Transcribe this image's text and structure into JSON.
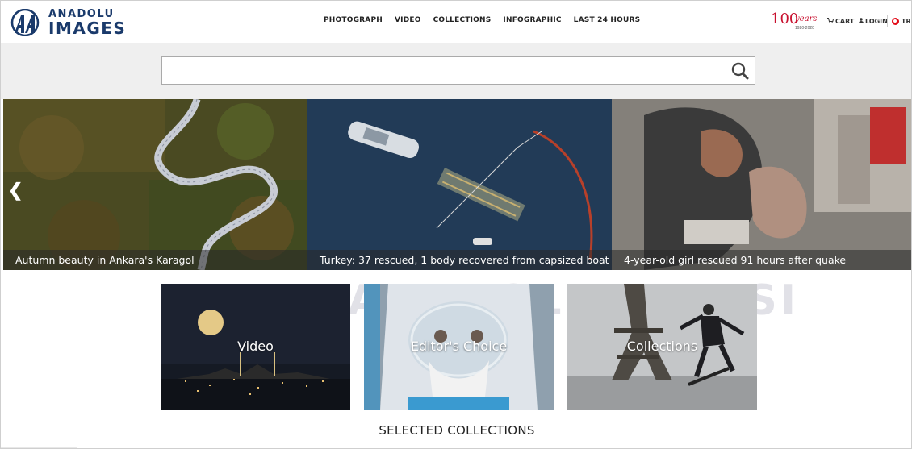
{
  "brand": {
    "line1": "ANADOLU",
    "line2": "IMAGES"
  },
  "nav": [
    "PHOTOGRAPH",
    "VIDEO",
    "COLLECTIONS",
    "INFOGRAPHIC",
    "LAST 24 HOURS"
  ],
  "centennial": {
    "number": "100",
    "word": "years",
    "range": "1920-2020"
  },
  "header_links": {
    "cart": "CART",
    "login": "LOGIN",
    "language": "TR"
  },
  "search": {
    "value": "",
    "placeholder": ""
  },
  "carousel": {
    "slides": [
      {
        "caption": "Autumn beauty in Ankara's Karagol"
      },
      {
        "caption": "Turkey: 37 rescued, 1 body recovered from capsized boat"
      },
      {
        "caption": "4-year-old girl rescued 91 hours after quake"
      }
    ]
  },
  "watermark": "ANADOLU AJANSI",
  "tiles": [
    {
      "label": "Video"
    },
    {
      "label": "Editor's Choice"
    },
    {
      "label": "Collections"
    }
  ],
  "section_title": "SELECTED COLLECTIONS",
  "colors": {
    "brand_blue": "#1a3a6b",
    "centennial_red": "#c8102e",
    "search_strip": "#efefef"
  }
}
